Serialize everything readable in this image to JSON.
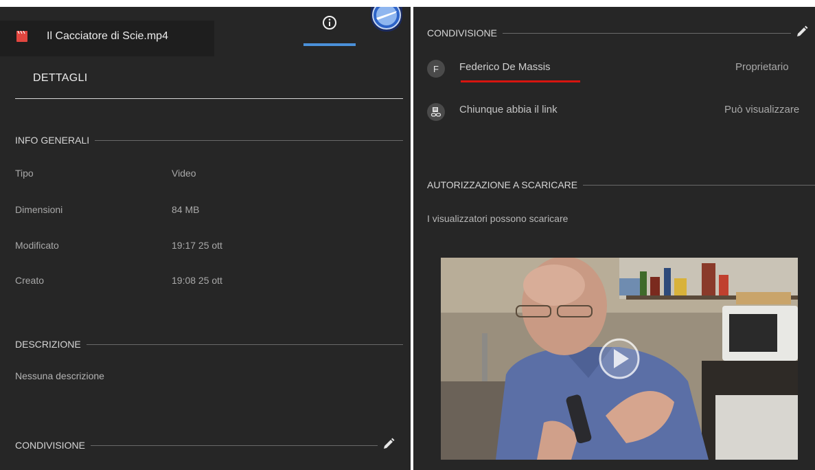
{
  "left": {
    "file_title": "Il Cacciatore di Scie.mp4",
    "tab_title": "DETTAGLI",
    "info_section": "INFO GENERALI",
    "info_rows": [
      {
        "label": "Tipo",
        "value": "Video"
      },
      {
        "label": "Dimensioni",
        "value": "84 MB"
      },
      {
        "label": "Modificato",
        "value": "19:17 25 ott"
      },
      {
        "label": "Creato",
        "value": "19:08 25 ott"
      }
    ],
    "desc_section": "DESCRIZIONE",
    "desc_text": "Nessuna descrizione",
    "share_section": "CONDIVISIONE"
  },
  "right": {
    "share_section": "CONDIVISIONE",
    "owner": {
      "initial": "F",
      "name": "Federico De Massis",
      "role": "Proprietario"
    },
    "link": {
      "text": "Chiunque abbia il link",
      "permission": "Può visualizzare"
    },
    "download_section": "AUTORIZZAZIONE A SCARICARE",
    "download_text": "I visualizzatori possono scaricare"
  },
  "icons": {
    "file": "video-file-icon",
    "info": "info-icon",
    "edit": "pencil-icon",
    "link": "link-icon",
    "play": "play-icon"
  },
  "colors": {
    "panel_bg": "#262626",
    "tab_underline": "#4a90d9",
    "owner_underline": "#d7150f",
    "file_icon": "#e2463f"
  }
}
